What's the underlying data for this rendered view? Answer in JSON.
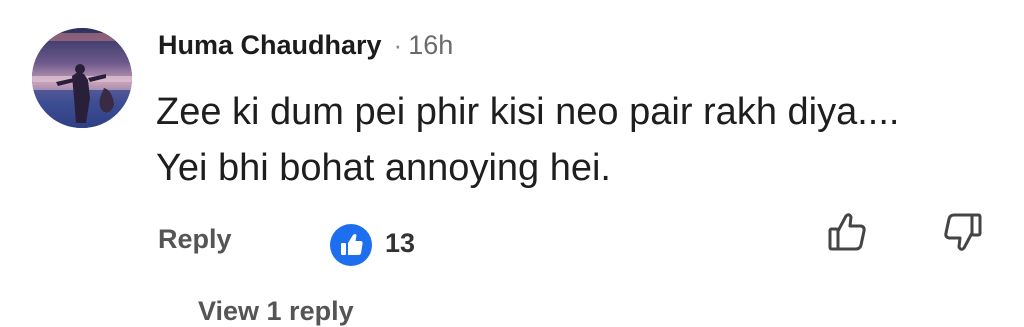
{
  "comment": {
    "author": "Huma Chaudhary",
    "separator": "·",
    "time": "16h",
    "text_line1": "Zee ki dum pei phir kisi neo pair rakh diya....",
    "text_line2": "Yei bhi bohat annoying hei."
  },
  "actions": {
    "reply_label": "Reply",
    "like_count": "13",
    "reaction_icon": "thumbs-up-icon",
    "upvote_icon": "thumbs-up-outline-icon",
    "downvote_icon": "thumbs-down-outline-icon"
  },
  "view_replies_label": "View 1 reply",
  "colors": {
    "reaction_badge": "#1e6ff0",
    "text_primary": "#1c1c1c",
    "text_secondary": "#555555"
  }
}
